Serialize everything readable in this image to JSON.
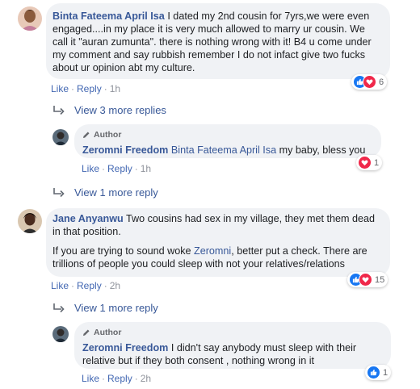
{
  "comments": [
    {
      "author": "Binta Fateema April Isa",
      "text": "I dated my 2nd cousin for 7yrs,we were even engaged....in my place it is very much allowed to marry ur cousin. We call it \"auran zumunta\". there is nothing wrong with it! B4 u come under my comment and say rubbish remember I do not infact give two fucks about ur opinion abt my culture.",
      "like": "Like",
      "reply": "Reply",
      "time": "1h",
      "reaction_count": "6",
      "view_more": "View 3 more replies"
    },
    {
      "badge": "Author",
      "author": "Zeromni Freedom",
      "mention": "Binta Fateema April Isa",
      "text": " my baby, bless you",
      "like": "Like",
      "reply": "Reply",
      "time": "1h",
      "reaction_count": "1",
      "view_more": "View 1 more reply"
    },
    {
      "author": "Jane Anyanwu",
      "text": " Two cousins had sex in my village, they met them dead in that position.",
      "text2_before": "If you are trying to sound woke ",
      "text2_mention": "Zeromni",
      "text2_after": ", better put a check. There are trillions of people you could sleep with not your relatives/relations",
      "like": "Like",
      "reply": "Reply",
      "time": "2h",
      "reaction_count": "15",
      "view_more": "View 1 more reply"
    },
    {
      "badge": "Author",
      "author": "Zeromni Freedom",
      "text": " I didn't say anybody must sleep with their relative but if they both consent , nothing wrong in it",
      "like": "Like",
      "reply": "Reply",
      "time": "2h",
      "reaction_count": "1"
    }
  ],
  "icons": {
    "reply_arrow": "reply-arrow-icon",
    "pencil": "pencil-icon",
    "like": "like-reaction-icon",
    "love": "love-reaction-icon"
  },
  "colors": {
    "link": "#385898",
    "bubble": "#f0f2f5",
    "like": "#1877f2",
    "love": "#f0284a"
  }
}
